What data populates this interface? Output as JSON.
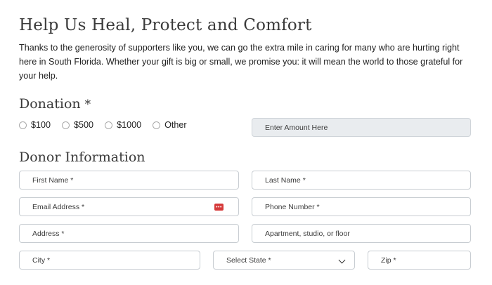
{
  "heading": "Help Us Heal, Protect and Comfort",
  "intro": "Thanks to the generosity of supporters like you, we can go the extra mile in caring for many who are hurting right here in South Florida. Whether your gift is big or small, we promise you: it will mean the world to those grateful for your help.",
  "donation": {
    "title": "Donation",
    "required_mark": "*",
    "options": [
      "$100",
      "$500",
      "$1000",
      "Other"
    ],
    "amount_placeholder": "Enter Amount Here"
  },
  "donor": {
    "title": "Donor Information",
    "first_name": "First Name *",
    "last_name": "Last Name *",
    "email": "Email Address *",
    "phone": "Phone Number *",
    "address": "Address *",
    "apartment": "Apartment, studio, or floor",
    "city": "City *",
    "state": "Select State *",
    "zip": "Zip *"
  },
  "colors": {
    "heading": "#3a3a3a",
    "field_border": "#c8cdd2",
    "amount_bg": "#e9ecef",
    "password_icon": "#d63b3b"
  },
  "icons": {
    "password_manager": "password-manager-icon",
    "select_arrow": "chevron-down-icon"
  }
}
